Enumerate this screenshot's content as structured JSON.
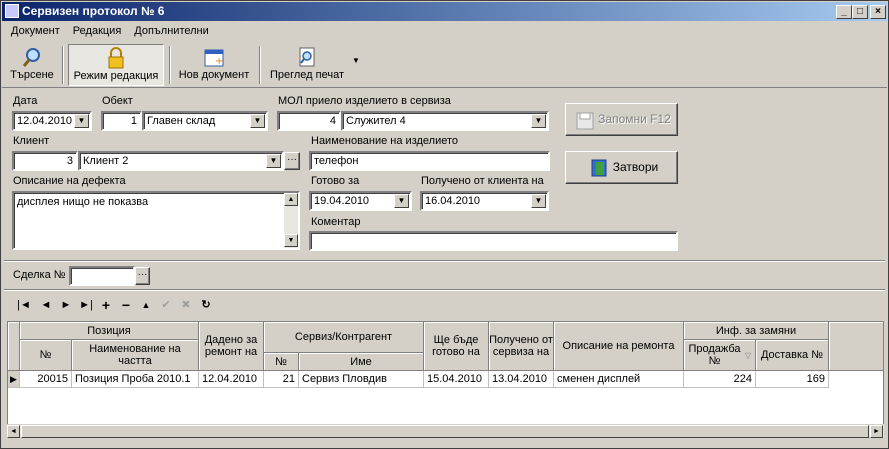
{
  "window": {
    "title": "Сервизен протокол № 6",
    "minimize": "_",
    "maximize": "□",
    "close": "×"
  },
  "menu": [
    "Документ",
    "Редакция",
    "Допълнителни"
  ],
  "toolbar": {
    "search": "Търсене",
    "edit_mode": "Режим редакция",
    "new_doc": "Нов документ",
    "print_preview": "Преглед печат"
  },
  "form": {
    "date_label": "Дата",
    "date": "12.04.2010",
    "object_label": "Обект",
    "object_num": "1",
    "object_name": "Главен склад",
    "mol_label": "МОЛ приело изделието в сервиза",
    "mol_num": "4",
    "mol_name": "Служител 4",
    "client_label": "Клиент",
    "client_num": "3",
    "client_name": "Клиент 2",
    "product_label": "Наименование на изделието",
    "product": "телефон",
    "defect_label": "Описание на дефекта",
    "defect": "дисплея нищо не показва",
    "ready_label": "Готово за",
    "ready": "19.04.2010",
    "received_label": "Получено от клиента на",
    "received": "16.04.2010",
    "comment_label": "Коментар",
    "comment": "",
    "save_button": "Запомни  F12",
    "close_button": "Затвори",
    "deal_label": "Сделка №",
    "deal": ""
  },
  "grid": {
    "headers": {
      "position": "Позиция",
      "pos_no": "№",
      "part_name": "Наименование на частта",
      "given": "Дадено за ремонт на",
      "service": "Сервиз/Контрагент",
      "svc_no": "№",
      "svc_name": "Име",
      "ready": "Ще бъде готово на",
      "received": "Получено от сервиза на",
      "repair_desc": "Описание на ремонта",
      "replacement": "Инф. за замяни",
      "sale_no": "Продажба №",
      "delivery_no": "Доставка №"
    },
    "rows": [
      {
        "pos_no": "20015",
        "part_name": "Позиция Проба 2010.1",
        "given": "12.04.2010",
        "svc_no": "21",
        "svc_name": "Сервиз Пловдив",
        "ready": "15.04.2010",
        "received": "13.04.2010",
        "repair_desc": "сменен дисплей",
        "sale_no": "224",
        "delivery_no": "169"
      }
    ]
  }
}
